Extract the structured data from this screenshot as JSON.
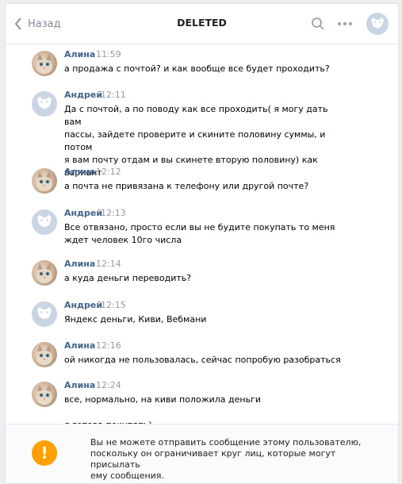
{
  "header": {
    "back_label": "Назад",
    "title": "DELETED",
    "search_icon": "search-icon",
    "more_icon": "more-icon",
    "avatar_icon": "vk-dog-icon"
  },
  "messages": [
    {
      "author": "Алина",
      "time": "11:59",
      "avatar": "cat-photo",
      "lines": [
        "а продажа с почтой? и как вообще все будет проходить?"
      ]
    },
    {
      "author": "Андрей",
      "time": "12:11",
      "avatar": "vk-dog-icon",
      "lines": [
        "Да с почтой, а по поводу как все проходить( я могу дать вам",
        "пассы, зайдете проверите и скините половину суммы, и потом",
        "я вам почту отдам и вы скинете вторую половину) как",
        "вариант"
      ]
    },
    {
      "author": "Алина",
      "time": "12:12",
      "avatar": "cat-photo",
      "lines": [
        "а почта не привязана к телефону или другой почте?"
      ]
    },
    {
      "author": "Андрей",
      "time": "12:13",
      "avatar": "vk-dog-icon",
      "lines": [
        "Все отвязано, просто если вы не будите покупать то меня",
        "ждет человек 10го числа"
      ]
    },
    {
      "author": "Алина",
      "time": "12:14",
      "avatar": "cat-photo",
      "lines": [
        "а куда деньги переводить?"
      ]
    },
    {
      "author": "Андрей",
      "time": "12:15",
      "avatar": "vk-dog-icon",
      "lines": [
        "Яндекс деньги, Киви, Вебмани"
      ]
    },
    {
      "author": "Алина",
      "time": "12:16",
      "avatar": "cat-photo",
      "lines": [
        "ой никогда не пользовалась, сейчас попробую разобраться"
      ]
    },
    {
      "author": "Алина",
      "time": "12:24",
      "avatar": "cat-photo",
      "lines": [
        "все, нормально, на киви положила деньги",
        "",
        "я готова покупать)"
      ]
    }
  ],
  "notice": {
    "icon": "warning-icon",
    "lines": [
      "Вы не можете отправить сообщение этому пользователю,",
      "поскольку он ограничивает круг лиц, которые могут присылать",
      "ему сообщения."
    ]
  },
  "colors": {
    "author": "#42648b",
    "time": "#939aa4",
    "warning": "#ffa000",
    "accent": "#828a99"
  }
}
